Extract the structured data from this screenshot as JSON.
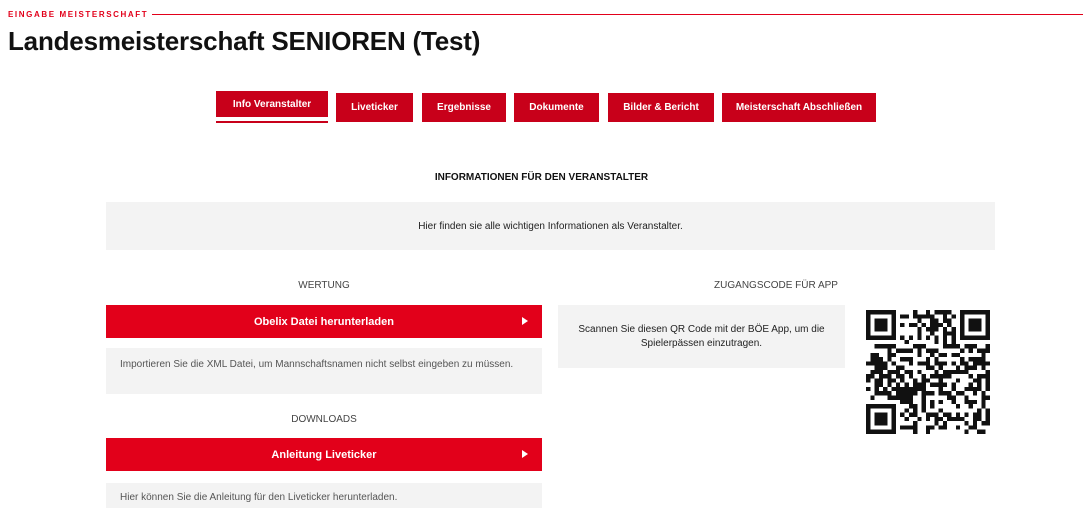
{
  "header": {
    "eyebrow": "EINGABE MEISTERSCHAFT",
    "title": "Landesmeisterschaft SENIOREN (Test)"
  },
  "tabs": [
    {
      "label": "Info Veranstalter",
      "active": true
    },
    {
      "label": "Liveticker",
      "active": false
    },
    {
      "label": "Ergebnisse",
      "active": false
    },
    {
      "label": "Dokumente",
      "active": false
    },
    {
      "label": "Bilder & Bericht",
      "active": false
    },
    {
      "label": "Meisterschaft Abschließen",
      "active": false
    }
  ],
  "main": {
    "section_title": "INFORMATIONEN FÜR DEN VERANSTALTER",
    "info_text": "Hier finden sie alle wichtigen Informationen als Veranstalter."
  },
  "wertung": {
    "label": "WERTUNG",
    "button_label": "Obelix Datei herunterladen",
    "note": "Importieren Sie die XML Datei, um Mannschaftsnamen nicht selbst eingeben zu müssen."
  },
  "downloads": {
    "label": "DOWNLOADS",
    "button_label": "Anleitung Liveticker",
    "note": "Hier können Sie die Anleitung für den Liveticker herunterladen."
  },
  "app_code": {
    "label": "ZUGANGSCODE FÜR APP",
    "text": "Scannen Sie diesen QR Code mit der BÖE App, um die Spielerpässen einzutragen."
  },
  "colors": {
    "accent": "#e2001a",
    "tab_red": "#c8001a",
    "panel_grey": "#f3f3f3"
  }
}
